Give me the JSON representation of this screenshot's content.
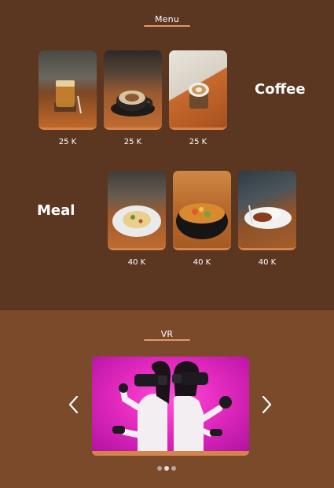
{
  "menu_section": {
    "title": "Menu",
    "coffee": {
      "heading": "Coffee",
      "items": [
        {
          "price": "25 K",
          "image": "iced-coffee-photo"
        },
        {
          "price": "25 K",
          "image": "cappuccino-photo"
        },
        {
          "price": "25 K",
          "image": "latte-photo"
        }
      ]
    },
    "meal": {
      "heading": "Meal",
      "items": [
        {
          "price": "40 K",
          "image": "pasta-photo"
        },
        {
          "price": "40 K",
          "image": "salad-bowl-photo"
        },
        {
          "price": "40 K",
          "image": "rice-plate-photo"
        }
      ]
    }
  },
  "vr_section": {
    "title": "VR",
    "carousel": {
      "image": "vr-players-photo",
      "prev_icon": "chevron-left-icon",
      "next_icon": "chevron-right-icon",
      "slides": 3,
      "active_slide": 2
    }
  },
  "colors": {
    "menu_bg": "#5b3620",
    "vr_bg": "#7a4a2b",
    "accent": "#d5844b"
  }
}
